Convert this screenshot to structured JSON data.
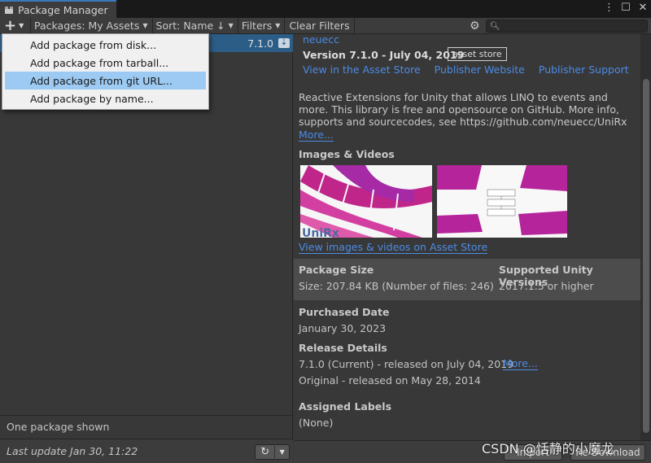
{
  "window": {
    "title": "Package Manager"
  },
  "toolbar": {
    "packages_filter": "Packages: My Assets",
    "sort": "Sort: Name ↓",
    "filters": "Filters",
    "clear_filters": "Clear Filters",
    "search_placeholder": ""
  },
  "add_menu": {
    "items": [
      {
        "label": "Add package from disk..."
      },
      {
        "label": "Add package from tarball..."
      },
      {
        "label": "Add package from git URL..."
      },
      {
        "label": "Add package by name..."
      }
    ],
    "highlighted_index": 2
  },
  "package_list": {
    "selected_version": "7.1.0",
    "count_text": "One package shown",
    "last_update": "Last update Jan 30, 11:22"
  },
  "details": {
    "publisher": "neuecc",
    "version_line": "Version 7.1.0 - July 04, 2019",
    "badge": "asset store",
    "links": [
      "View in the Asset Store",
      "Publisher Website",
      "Publisher Support"
    ],
    "description": "Reactive Extensions for Unity that allows LINQ to events and more. This library is free and opensource on GitHub. More info, supports and sourcecodes, see https://github.com/neuecc/UniRx",
    "more_label": "More...",
    "images_heading": "Images & Videos",
    "view_images_link": "View images & videos on Asset Store",
    "package_size_heading": "Package Size",
    "package_size_value": "Size: 207.84 KB (Number of files: 246)",
    "supported_heading": "Supported Unity Versions",
    "supported_value": "2017.1.5 or higher",
    "purchased_heading": "Purchased Date",
    "purchased_value": "January 30, 2023",
    "release_heading": "Release Details",
    "release_current": "7.1.0 (Current) - released on July 04, 2019",
    "release_more": "More...",
    "release_original": "Original - released on May 28, 2014",
    "labels_heading": "Assigned Labels",
    "labels_value": "(None)"
  },
  "footer_buttons": {
    "import": "Import",
    "redownload": "Re-Download"
  },
  "watermark": "CSDN @恬静的小魔龙",
  "colors": {
    "accent_link": "#4c8be5",
    "selection": "#2c5d87",
    "menu_highlight": "#9ccaf2"
  }
}
